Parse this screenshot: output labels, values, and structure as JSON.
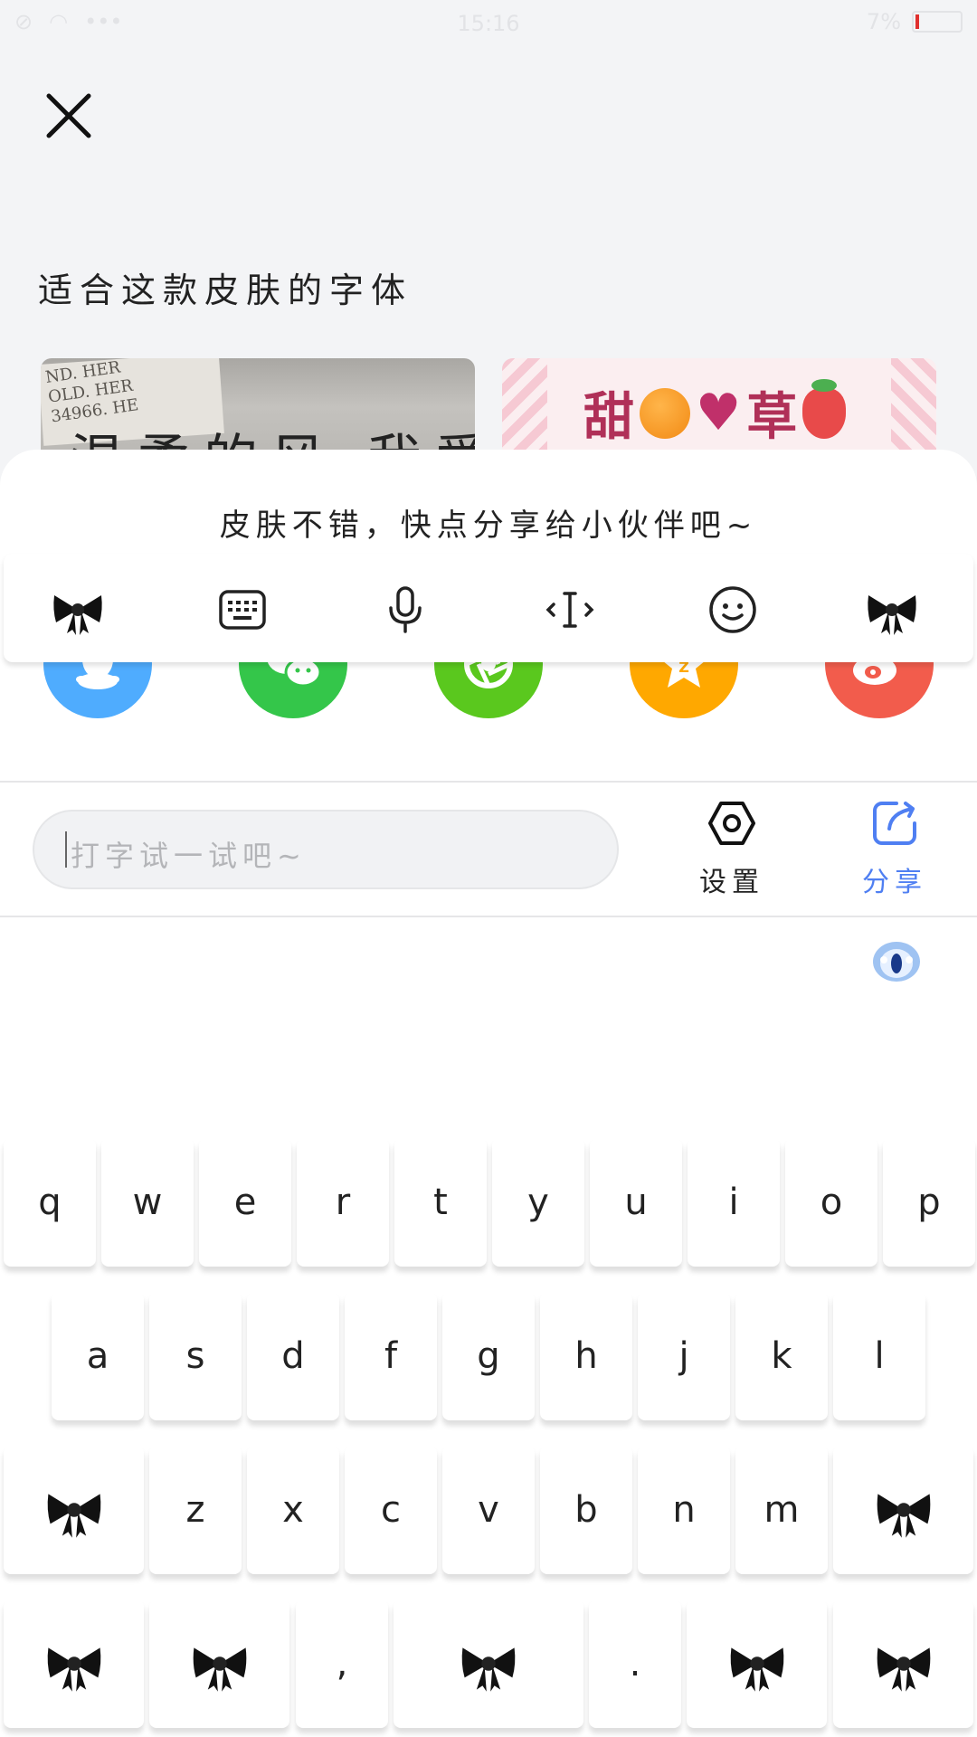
{
  "status_bar": {
    "time": "15:16",
    "battery": "7%",
    "dots": "•••"
  },
  "section_title": "适合这款皮肤的字体",
  "font_previews": [
    {
      "text": "温柔的风 我爱你",
      "scrap": "ND. HER\nOLD. HER\n34966. HE"
    },
    {
      "text_left": "甜",
      "text_right": "草"
    }
  ],
  "share_sheet": {
    "hint": "皮肤不错，快点分享给小伙伴吧~",
    "targets": [
      {
        "name": "QQ",
        "icon": "qq-icon",
        "color": "#4facfe"
      },
      {
        "name": "WeChat",
        "icon": "wechat-icon",
        "color": "#34c64a"
      },
      {
        "name": "Moments",
        "icon": "moments-icon",
        "color": "#5ac81e"
      },
      {
        "name": "QZone",
        "icon": "qzone-icon",
        "color": "#ffa800"
      },
      {
        "name": "Weibo",
        "icon": "weibo-icon",
        "color": "#f25c4c"
      }
    ]
  },
  "input": {
    "placeholder": "打字试一试吧~"
  },
  "tools": {
    "settings_label": "设置",
    "share_label": "分享"
  },
  "keyboard": {
    "row1": [
      "q",
      "w",
      "e",
      "r",
      "t",
      "y",
      "u",
      "i",
      "o",
      "p"
    ],
    "row2": [
      "a",
      "s",
      "d",
      "f",
      "g",
      "h",
      "j",
      "k",
      "l"
    ],
    "row3": [
      "z",
      "x",
      "c",
      "v",
      "b",
      "n",
      "m"
    ],
    "row4_comma": ",",
    "row4_period": "."
  }
}
